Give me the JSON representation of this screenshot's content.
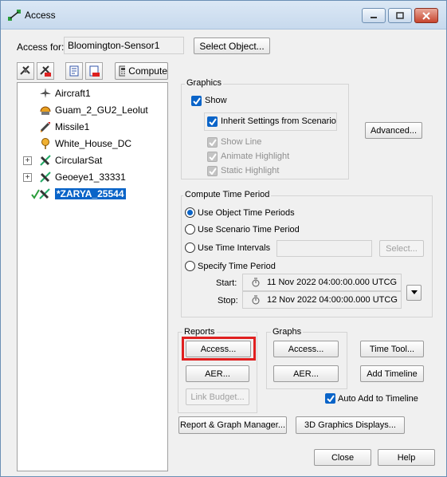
{
  "window": {
    "title": "Access",
    "access_for_label": "Access for:",
    "access_for_value": "Bloomington-Sensor1",
    "select_object_label": "Select Object..."
  },
  "toolbar": {
    "compute_label": "Compute"
  },
  "tree": {
    "items": [
      {
        "label": "Aircraft1",
        "icon": "aircraft-icon"
      },
      {
        "label": "Guam_2_GU2_Leolut",
        "icon": "facility-icon"
      },
      {
        "label": "Missile1",
        "icon": "missile-icon"
      },
      {
        "label": "White_House_DC",
        "icon": "place-icon"
      },
      {
        "label": "CircularSat",
        "icon": "satellite-icon"
      },
      {
        "label": "Geoeye1_33331",
        "icon": "satellite-icon"
      },
      {
        "label": "*ZARYA_25544",
        "icon": "satellite-icon"
      }
    ]
  },
  "graphics": {
    "title": "Graphics",
    "show_label": "Show",
    "inherit_label": "Inherit Settings from Scenario",
    "show_line_label": "Show Line",
    "animate_highlight_label": "Animate Highlight",
    "static_highlight_label": "Static Highlight",
    "advanced_label": "Advanced..."
  },
  "compute_time": {
    "title": "Compute Time Period",
    "options": [
      "Use Object Time Periods",
      "Use Scenario Time Period",
      "Use Time Intervals",
      "Specify Time Period"
    ],
    "select_label": "Select...",
    "start_label": "Start:",
    "start_value": "11 Nov 2022 04:00:00.000 UTCG",
    "stop_label": "Stop:",
    "stop_value": "12 Nov 2022 04:00:00.000 UTCG"
  },
  "reports": {
    "title": "Reports",
    "access_label": "Access...",
    "aer_label": "AER...",
    "link_budget_label": "Link Budget..."
  },
  "graphs": {
    "title": "Graphs",
    "access_label": "Access...",
    "aer_label": "AER..."
  },
  "side_buttons": {
    "time_tool_label": "Time Tool...",
    "add_timeline_label": "Add Timeline",
    "auto_add_label": "Auto Add to Timeline"
  },
  "bottom": {
    "report_graph_manager_label": "Report & Graph Manager...",
    "graphics_displays_label": "3D Graphics Displays...",
    "close_label": "Close",
    "help_label": "Help"
  },
  "colors": {
    "accent": "#0a64c8",
    "highlight_border": "#e02020"
  }
}
